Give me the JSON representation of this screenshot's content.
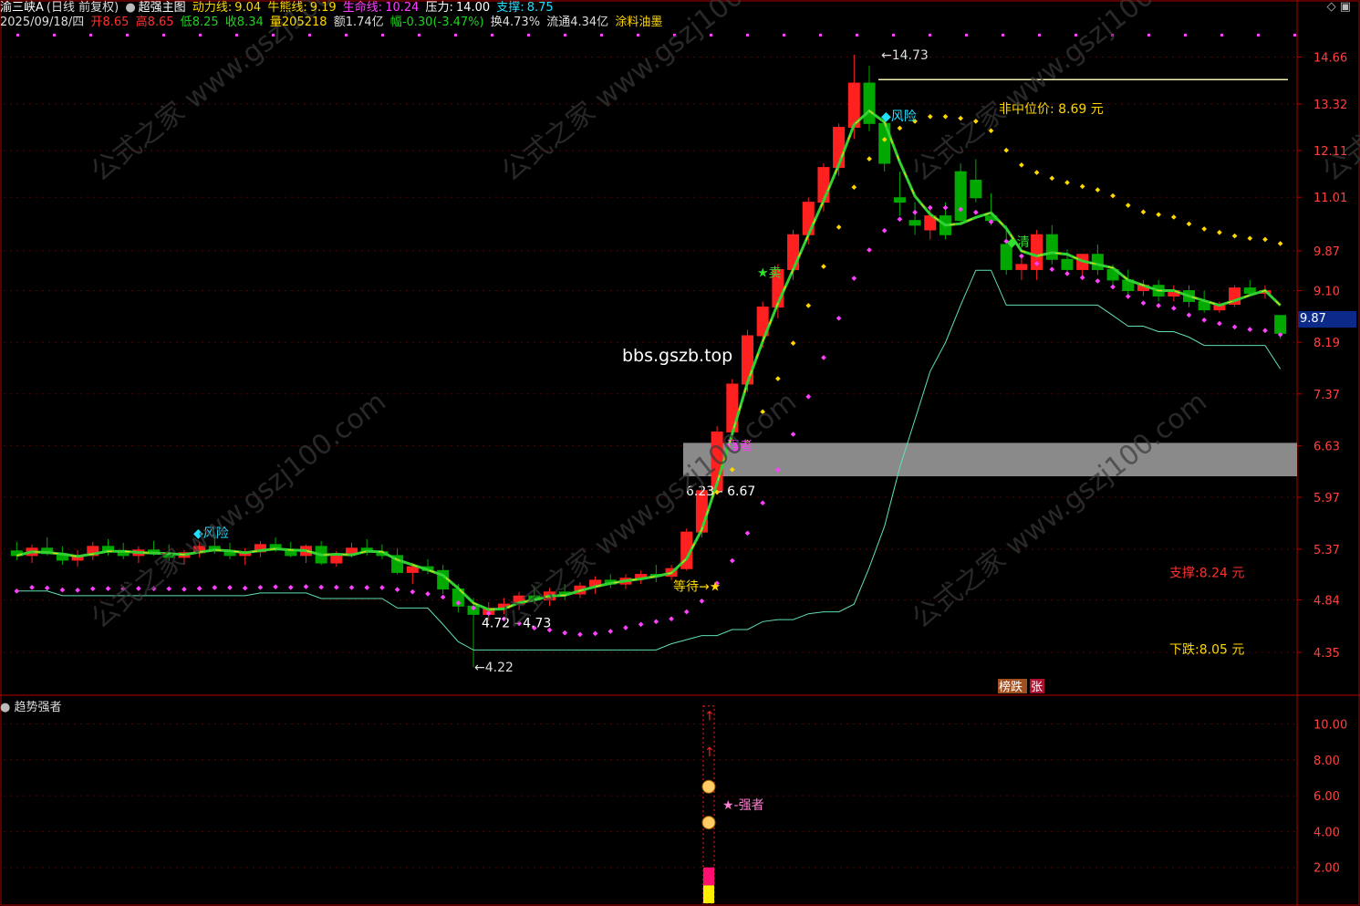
{
  "header": {
    "stock": "渝三峡A",
    "period": "(日线 前复权)",
    "date": "2025/09/18/四",
    "open_label": "开",
    "open": "8.65",
    "high_label": "高",
    "high": "8.65",
    "low_label": "低",
    "low": "8.25",
    "close_label": "收",
    "close": "8.34",
    "volume_label": "量",
    "volume": "205218",
    "amount_label": "额",
    "amount": "1.74亿",
    "change_label": "幅",
    "change": "-0.30(-3.47%)",
    "turnover_label": "换",
    "turnover": "4.73%",
    "float_label": "流通",
    "float_cap": "4.34亿",
    "sector": "涂料油墨",
    "indicator_name": "超强主图",
    "dongli_label": "动力线:",
    "dongli": "9.04",
    "niuxiong_label": "牛熊线:",
    "niuxiong": "9.19",
    "shengming_label": "生命线:",
    "shengming": "10.24",
    "yali_label": "压力:",
    "yali": "14.00",
    "zhicheng_label": "支撑:",
    "zhicheng": "8.75"
  },
  "sub_indicator": {
    "name": "趋势强者"
  },
  "current_price_tag": "9.87",
  "colors": {
    "up": "#ff2020",
    "down": "#00a800",
    "axis": "#b00000",
    "yellow": "#ffd700",
    "magenta": "#ff40ff",
    "green_line": "#32d232",
    "grey_band": "#8a8a8a",
    "cyan": "#20e0ff",
    "white": "#ffffff"
  },
  "chart_data": [
    {
      "type": "candlestick",
      "y_ticks": [
        14.66,
        13.32,
        12.11,
        11.01,
        9.87,
        9.1,
        8.19,
        7.37,
        6.63,
        5.97,
        5.37,
        4.84,
        4.35
      ],
      "y_scale": "log",
      "ylim": [
        4.0,
        15.4
      ],
      "candles": [
        [
          5.35,
          5.45,
          5.25,
          5.3
        ],
        [
          5.3,
          5.42,
          5.22,
          5.38
        ],
        [
          5.38,
          5.5,
          5.3,
          5.32
        ],
        [
          5.32,
          5.4,
          5.2,
          5.25
        ],
        [
          5.25,
          5.36,
          5.18,
          5.3
        ],
        [
          5.3,
          5.45,
          5.25,
          5.4
        ],
        [
          5.4,
          5.48,
          5.3,
          5.34
        ],
        [
          5.34,
          5.44,
          5.26,
          5.3
        ],
        [
          5.3,
          5.4,
          5.22,
          5.36
        ],
        [
          5.36,
          5.46,
          5.3,
          5.32
        ],
        [
          5.32,
          5.42,
          5.24,
          5.28
        ],
        [
          5.28,
          5.36,
          5.2,
          5.33
        ],
        [
          5.33,
          5.45,
          5.28,
          5.4
        ],
        [
          5.4,
          5.5,
          5.32,
          5.35
        ],
        [
          5.35,
          5.44,
          5.26,
          5.3
        ],
        [
          5.3,
          5.38,
          5.2,
          5.34
        ],
        [
          5.34,
          5.46,
          5.28,
          5.42
        ],
        [
          5.42,
          5.5,
          5.34,
          5.36
        ],
        [
          5.36,
          5.45,
          5.28,
          5.3
        ],
        [
          5.3,
          5.42,
          5.22,
          5.4
        ],
        [
          5.4,
          5.46,
          5.2,
          5.22
        ],
        [
          5.22,
          5.35,
          5.18,
          5.32
        ],
        [
          5.32,
          5.44,
          5.28,
          5.38
        ],
        [
          5.38,
          5.48,
          5.3,
          5.34
        ],
        [
          5.34,
          5.42,
          5.26,
          5.3
        ],
        [
          5.3,
          5.38,
          5.1,
          5.12
        ],
        [
          5.12,
          5.22,
          5.0,
          5.18
        ],
        [
          5.18,
          5.26,
          5.1,
          5.14
        ],
        [
          5.14,
          5.2,
          4.9,
          4.95
        ],
        [
          4.95,
          5.0,
          4.72,
          4.78
        ],
        [
          4.78,
          4.86,
          4.22,
          4.7
        ],
        [
          4.7,
          4.82,
          4.64,
          4.76
        ],
        [
          4.76,
          4.86,
          4.7,
          4.8
        ],
        [
          4.8,
          4.92,
          4.74,
          4.88
        ],
        [
          4.88,
          4.98,
          4.8,
          4.84
        ],
        [
          4.84,
          4.96,
          4.78,
          4.92
        ],
        [
          4.92,
          5.0,
          4.84,
          4.9
        ],
        [
          4.9,
          5.02,
          4.86,
          4.98
        ],
        [
          4.98,
          5.08,
          4.9,
          5.04
        ],
        [
          5.04,
          5.1,
          4.96,
          5.0
        ],
        [
          5.0,
          5.1,
          4.95,
          5.06
        ],
        [
          5.06,
          5.14,
          5.0,
          5.1
        ],
        [
          5.1,
          5.2,
          5.02,
          5.08
        ],
        [
          5.08,
          5.2,
          5.04,
          5.16
        ],
        [
          5.16,
          5.6,
          5.14,
          5.56
        ],
        [
          5.56,
          6.1,
          5.5,
          6.05
        ],
        [
          6.05,
          6.9,
          6.0,
          6.82
        ],
        [
          6.82,
          7.6,
          6.7,
          7.52
        ],
        [
          7.52,
          8.4,
          7.4,
          8.3
        ],
        [
          8.3,
          8.9,
          8.1,
          8.8
        ],
        [
          8.8,
          9.6,
          8.6,
          9.5
        ],
        [
          9.5,
          10.3,
          9.3,
          10.2
        ],
        [
          10.2,
          11.0,
          10.0,
          10.9
        ],
        [
          10.9,
          11.8,
          10.7,
          11.7
        ],
        [
          11.7,
          12.8,
          11.5,
          12.7
        ],
        [
          12.7,
          14.73,
          12.4,
          13.9
        ],
        [
          13.9,
          14.4,
          12.6,
          12.8
        ],
        [
          12.8,
          12.9,
          11.6,
          11.8
        ],
        [
          11.0,
          11.6,
          10.6,
          10.9
        ],
        [
          10.5,
          10.9,
          10.2,
          10.4
        ],
        [
          10.3,
          10.8,
          10.1,
          10.6
        ],
        [
          10.6,
          10.9,
          10.1,
          10.2
        ],
        [
          11.6,
          11.8,
          10.4,
          10.5
        ],
        [
          11.4,
          11.9,
          10.9,
          11.0
        ],
        [
          10.6,
          11.1,
          10.4,
          10.5
        ],
        [
          10.0,
          10.4,
          9.4,
          9.5
        ],
        [
          9.5,
          9.8,
          9.3,
          9.6
        ],
        [
          9.5,
          10.3,
          9.3,
          10.2
        ],
        [
          10.2,
          10.4,
          9.6,
          9.7
        ],
        [
          9.7,
          9.9,
          9.4,
          9.5
        ],
        [
          9.5,
          9.7,
          9.3,
          9.8
        ],
        [
          9.8,
          10.0,
          9.4,
          9.5
        ],
        [
          9.5,
          9.6,
          9.2,
          9.3
        ],
        [
          9.3,
          9.5,
          9.0,
          9.1
        ],
        [
          9.1,
          9.3,
          9.0,
          9.2
        ],
        [
          9.2,
          9.3,
          8.9,
          9.0
        ],
        [
          9.0,
          9.2,
          8.9,
          9.1
        ],
        [
          9.1,
          9.2,
          8.8,
          8.9
        ],
        [
          8.9,
          9.1,
          8.7,
          8.75
        ],
        [
          8.75,
          8.9,
          8.7,
          8.85
        ],
        [
          8.85,
          9.2,
          8.8,
          9.15
        ],
        [
          9.15,
          9.3,
          9.0,
          9.05
        ],
        [
          9.05,
          9.2,
          8.95,
          9.1
        ],
        [
          8.65,
          8.65,
          8.25,
          8.34
        ]
      ],
      "annotations": [
        {
          "text": "14.73",
          "price": 14.73
        },
        {
          "text": "4.22",
          "price": 4.22
        },
        {
          "text": "◆风险",
          "price": 13.0,
          "color": "cyan"
        },
        {
          "text": "◆风险",
          "price": 5.55,
          "color": "cyan"
        },
        {
          "text": "非中位价: 8.69 元",
          "price": 13.2,
          "color": "yellow"
        },
        {
          "text": "◆清",
          "price": 10.05,
          "color": "green"
        },
        {
          "text": "★卖",
          "price": 9.45,
          "color": "green"
        },
        {
          "text": "bbs.gszb.top",
          "price": 7.95,
          "color": "white"
        },
        {
          "text": "强者",
          "price": 6.63,
          "color": "magenta"
        },
        {
          "text": "6.23 - 6.67",
          "price": 6.05,
          "color": "white"
        },
        {
          "text": "4.72 - 4.73",
          "price": 4.62,
          "color": "white"
        },
        {
          "text": "等待→★",
          "price": 4.98,
          "color": "yellow"
        },
        {
          "text": "支撑:8.24 元",
          "price": 5.12,
          "color": "red"
        },
        {
          "text": "下跌:8.05 元",
          "price": 4.38,
          "color": "yellow"
        }
      ],
      "resistance_line": 14.0,
      "grey_band": [
        6.23,
        6.67
      ]
    },
    {
      "type": "bar",
      "title": "趋势强者",
      "y_ticks": [
        10.0,
        8.0,
        6.0,
        4.0,
        2.0
      ],
      "ylim": [
        0,
        11.5
      ],
      "marker_label": "★-强者"
    }
  ],
  "badges": {
    "bang": "榜",
    "die": "跌",
    "zhang": "张"
  },
  "watermark": "公式之家 www.gszj100.com"
}
